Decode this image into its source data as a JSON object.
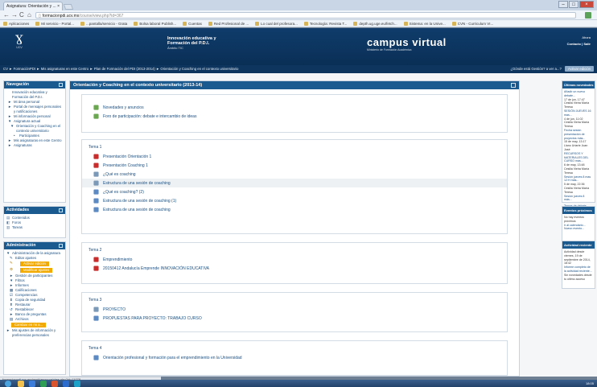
{
  "browser": {
    "tab_title": "Asignatura: Orientación y ...",
    "url_host": "formacionpdi.ucv.mx",
    "url_path": "/course/view.php?id=367",
    "bookmarks": [
      "Aplicaciones",
      "Mi servicio - Portal...",
      "...pantalla/servicio - Grata",
      "Bolsa laboral Publish...",
      "Cuentas",
      "Red Profesional de ...",
      "Lo cual del profesora...",
      "Tecnología: Revista T...",
      "depth.ug.uge.eu/fetch...",
      "Sistema: en la Unive...",
      "CVN - Curriculum VI..."
    ]
  },
  "header": {
    "logo_caption": "UCV",
    "center_title_1": "Innovación educativa y",
    "center_title_2": "Formación del P.D.I.",
    "center_sub": "Ámbito TIC",
    "campus_big": "campus virtual",
    "campus_small": "Ministerio de Formación Académica",
    "right_top": "Ahora",
    "right_links": "Contacto | Salir"
  },
  "breadcrumb": {
    "path": "CV ► FormaciónPDI ► Mis asignaturas en este Centro ► Plan de Formación del PDI (2013-2014) ► Orientación y Coaching en el contexto universitario",
    "right_text": "¿Dónde está Gestión? a ver a...?",
    "button": "Activar edición"
  },
  "left": {
    "nav": {
      "title": "Navegación",
      "items": [
        "Innovación educativa y Formación del P.D.I.",
        "Mi área personal",
        "Portal de mensajes personales y notificaciones",
        "Mi información personal",
        "Asignatura actual",
        "Orientación y Coaching en el contexto universitario",
        "Participantes",
        "Mis asignaturas en este Centro",
        "Asignaturas"
      ]
    },
    "activities": {
      "title": "Actividades",
      "items": [
        "Contenidos",
        "Foros",
        "Tareas"
      ]
    },
    "admin": {
      "title": "Administración",
      "items": [
        "Administración de la asignatura",
        "Editar ajustes",
        "Activar edición",
        "Modificar ajustes",
        "Gestión de participantes",
        "Filtros",
        "Informes",
        "Calificaciones",
        "Competencias",
        "Copia de seguridad",
        "Restaurar",
        "Restablecer",
        "Banco de preguntas",
        "Archivos",
        "Cambiar en mi a...",
        "Mis ajustes de información y preferencias personales"
      ]
    }
  },
  "main": {
    "title": "Orientación y Coaching en el contexto universitario (2013-14)",
    "intro": [
      "Novedades y anuncios",
      "Foro de participación: debate e intercambio de ideas"
    ],
    "sections": [
      {
        "title": "Tema 1",
        "items": [
          "Presentación Orientación 1",
          "Presentación Coaching 1",
          "¿Qué es coaching",
          "Estructura de una sesión de coaching",
          "¿Qué es coaching? (2)",
          "Estructura de una sesión de coaching (1)",
          "Estructura de una sesión de coaching"
        ]
      },
      {
        "title": "Tema 2",
        "items": [
          "Emprendimiento",
          "20150412 Andalucía Emprende INNOVACIÓN EDUCATIVA"
        ]
      },
      {
        "title": "Tema 3",
        "items": [
          "PROYECTO",
          "PROPUESTAS PARA PROYECTO: TRABAJO CURSO"
        ]
      },
      {
        "title": "Tema 4",
        "items": [
          "Orientación profesional y formación para el emprendimiento en la Universidad"
        ]
      }
    ]
  },
  "right": {
    "news": {
      "title": "Últimas novedades",
      "body": [
        "Añadir un nuevo debate...",
        "17 de jun, 17:47",
        "Cesilia Vieira María Teresa",
        "SESIÓN JUEVES 16 mas...",
        "4 de jun, 11:02",
        "Cesilia Vieira María Teresa",
        "Fecha sesión presentación de proyectos más...",
        "15 de may, 13:17",
        "Llano Uriarte Juan José",
        "RECURSOS Y MATERIALES DEL CURSO más...",
        "6 de may, 13:48",
        "Cesilia Vieira María Teresa",
        "Sesión jueves 8 mas 12:H más...",
        "5 de may, 22:36",
        "Cesilia Vieira María Teresa",
        "Sesión jueves 8 más..."
      ],
      "footer": "Temas de debate anteriores..."
    },
    "upcoming": {
      "title": "Eventos próximos",
      "body": [
        "No hay eventos próximos",
        "Ir al calendario...",
        "Nuevo evento..."
      ]
    },
    "recent": {
      "title": "Actividad reciente",
      "body": [
        "Actividad desde viernes, 19 de septiembre de 2014, 18:42",
        "Informe completo de la actividad reciente...",
        "Sin novedades desde tu último acceso"
      ]
    }
  },
  "statusbar": "formacionpdi.ucv.mx/mod/resource/view.php?id=11078",
  "clock": "18:05"
}
